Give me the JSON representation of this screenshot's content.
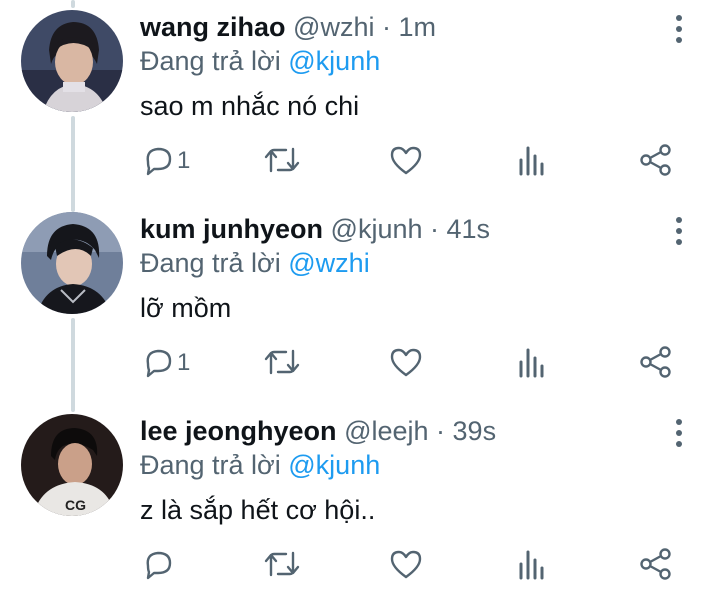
{
  "tweets": [
    {
      "name": "wang zihao",
      "handle": "@wzhi",
      "time": "· 1m",
      "reply_prefix": "Đang trả lời ",
      "reply_to": "@kjunh",
      "text": "sao m nhắc nó chi",
      "reply_count": "1"
    },
    {
      "name": "kum junhyeon",
      "handle": "@kjunh",
      "time": "· 41s",
      "reply_prefix": "Đang trả lời ",
      "reply_to": "@wzhi",
      "text": "lỡ mồm",
      "reply_count": "1"
    },
    {
      "name": "lee jeonghyeon",
      "handle": "@leejh",
      "time": "· 39s",
      "reply_prefix": "Đang trả lời ",
      "reply_to": "@kjunh",
      "text": "z là sắp hết cơ hội..",
      "reply_count": ""
    }
  ],
  "colors": {
    "accent": "#1d9bf0",
    "secondary_text": "#536471",
    "icon": "#536471",
    "thread_line": "#cfd9de"
  },
  "icons": [
    "reply-icon",
    "retweet-icon",
    "like-icon",
    "views-icon",
    "share-icon",
    "more-options-icon"
  ]
}
